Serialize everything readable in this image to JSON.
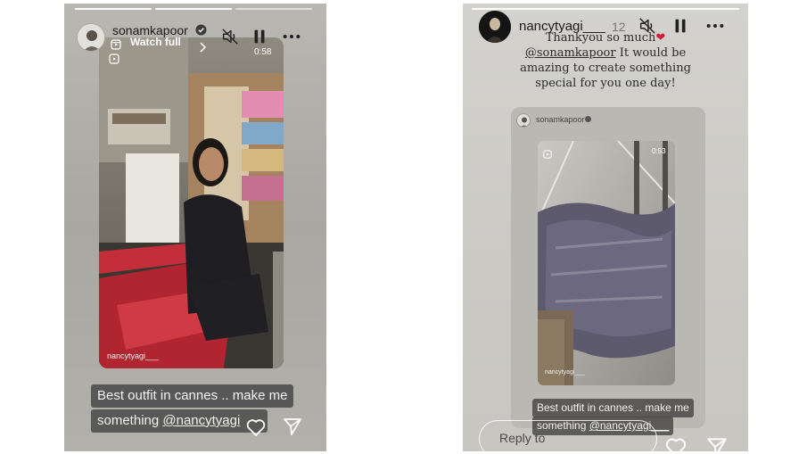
{
  "left_story": {
    "username": "sonamkapoor",
    "verified_icon": "verified-badge-icon",
    "watch_full_label": "Watch full",
    "video_duration": "0:58",
    "video_watermark": "nancytyagi___",
    "caption_line1": "Best outfit in cannes  .. make me",
    "caption_line2_prefix": "something ",
    "caption_mention": "@nancytyagi",
    "icons": [
      "mute-icon",
      "pause-icon",
      "more-icon",
      "like-heart-icon",
      "send-icon",
      "reels-icon",
      "chevron-right-icon"
    ]
  },
  "right_story": {
    "username": "nancytyagi___",
    "timestamp": "12",
    "message_line1": "Thankyou so much",
    "message_mention": "@sonamkapoor",
    "message_line2_suffix": " It would be",
    "message_line3": "amazing to create something",
    "message_line4": "special for you one day!",
    "shared_story": {
      "username": "sonamkapoor",
      "video_duration": "0:53",
      "video_watermark": "nancytyagi___",
      "caption_line1": "Best outfit in cannes  .. make me",
      "caption_line2_prefix": "something ",
      "caption_mention": "@nancytyagi___"
    },
    "reply_placeholder": "Reply to",
    "icons": [
      "mute-icon",
      "pause-icon",
      "more-icon",
      "heart-emoji-icon",
      "like-heart-icon",
      "send-icon"
    ]
  }
}
